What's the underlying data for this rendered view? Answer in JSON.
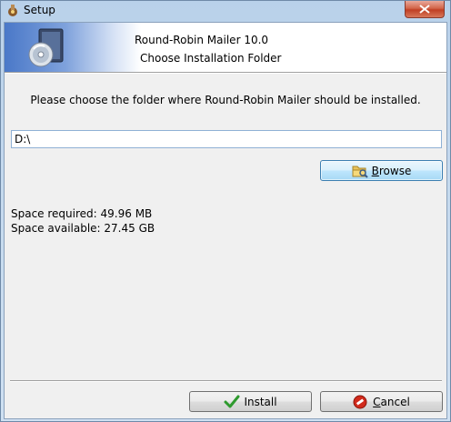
{
  "window": {
    "title": "Setup",
    "close_icon": "close-icon"
  },
  "header": {
    "title": "Round-Robin Mailer 10.0",
    "subtitle": "Choose Installation Folder",
    "icon": "cd-install-icon"
  },
  "main": {
    "instruction": "Please choose the folder where Round-Robin Mailer should be installed.",
    "install_path_value": "D:\\",
    "browse_label_mnemonic": "B",
    "browse_label_rest": "rowse",
    "space_required": "Space required: 49.96 MB",
    "space_available": "Space available: 27.45 GB"
  },
  "footer": {
    "install_label": "Install",
    "cancel_label_mnemonic": "C",
    "cancel_label_rest": "ancel"
  },
  "colors": {
    "accent": "#3c7fb1",
    "install_check": "#2e9a2e",
    "cancel_red": "#d12a1c"
  }
}
